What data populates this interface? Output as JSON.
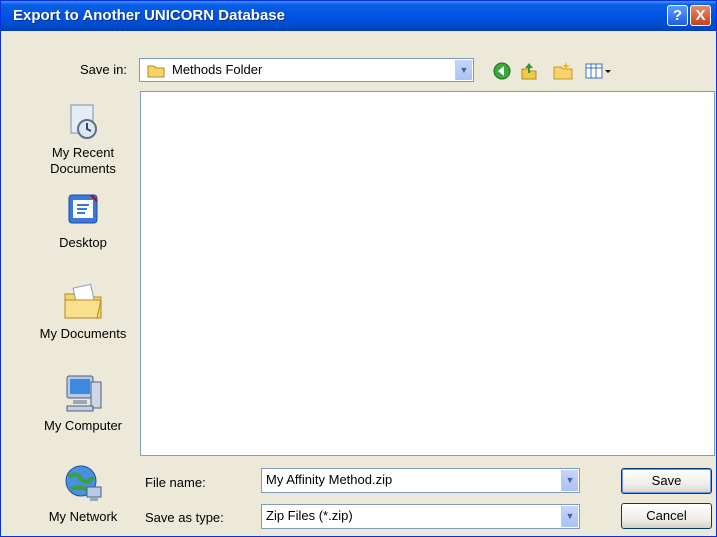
{
  "window": {
    "title": "Export to Another UNICORN Database",
    "help_button": "?",
    "close_button": "X"
  },
  "save_in": {
    "label": "Save in:",
    "value": "Methods Folder"
  },
  "toolbar": {
    "icons": [
      "back-icon",
      "up-folder-icon",
      "new-folder-icon",
      "views-menu-icon"
    ]
  },
  "places": [
    {
      "label": "My Recent Documents",
      "icon": "recent-documents-icon"
    },
    {
      "label": "Desktop",
      "icon": "desktop-icon"
    },
    {
      "label": "My Documents",
      "icon": "my-documents-icon"
    },
    {
      "label": "My Computer",
      "icon": "my-computer-icon"
    },
    {
      "label": "My Network",
      "icon": "my-network-icon"
    }
  ],
  "file_name": {
    "label": "File name:",
    "value": "My Affinity Method.zip"
  },
  "save_as_type": {
    "label": "Save as type:",
    "value": "Zip Files (*.zip)"
  },
  "buttons": {
    "save": "Save",
    "cancel": "Cancel"
  }
}
